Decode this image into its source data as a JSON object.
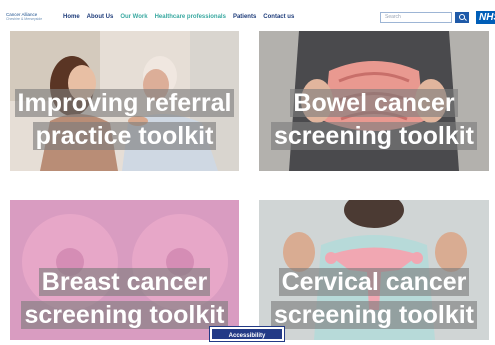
{
  "logo": {
    "line1": "Cancer Alliance",
    "line2": "Cheshire & Merseyside"
  },
  "nav": [
    "Home",
    "About Us",
    "Our Work",
    "Healthcare professionals",
    "Patients",
    "Contact us"
  ],
  "search": {
    "placeholder": "Search"
  },
  "brand": {
    "label": "NHS",
    "color": "#005eb8"
  },
  "cards": [
    {
      "line1": "Improving referral",
      "line2": "practice toolkit"
    },
    {
      "line1": "Bowel cancer",
      "line2": "screening toolkit"
    },
    {
      "line1": "Breast cancer",
      "line2": "screening toolkit"
    },
    {
      "line1": "Cervical cancer",
      "line2": "screening toolkit"
    }
  ],
  "accessibility": {
    "label": "Accessibility"
  },
  "colors": {
    "nav_text": "#1e3c7a",
    "nav_highlight": "#3aa9a1",
    "accent": "#1f5aa8"
  }
}
